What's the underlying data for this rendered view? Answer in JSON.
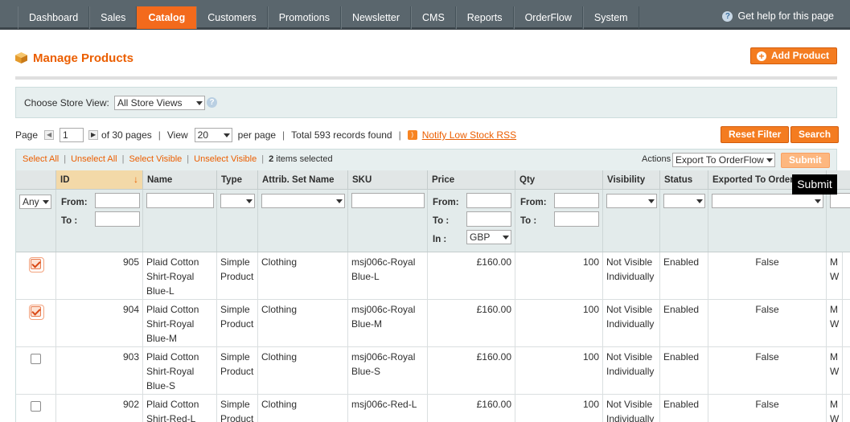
{
  "nav": {
    "items": [
      {
        "label": "Dashboard",
        "active": false
      },
      {
        "label": "Sales",
        "active": false
      },
      {
        "label": "Catalog",
        "active": true
      },
      {
        "label": "Customers",
        "active": false
      },
      {
        "label": "Promotions",
        "active": false
      },
      {
        "label": "Newsletter",
        "active": false
      },
      {
        "label": "CMS",
        "active": false
      },
      {
        "label": "Reports",
        "active": false
      },
      {
        "label": "OrderFlow",
        "active": false
      },
      {
        "label": "System",
        "active": false
      }
    ],
    "help_label": "Get help for this page"
  },
  "header": {
    "title": "Manage Products",
    "add_button": "Add Product"
  },
  "store_view": {
    "label": "Choose Store View:",
    "selected": "All Store Views"
  },
  "pager": {
    "page_label": "Page",
    "current_page": "1",
    "of_pages": "of 30 pages",
    "view_label": "View",
    "per_page_value": "20",
    "per_page_label": "per page",
    "total": "Total 593 records found",
    "rss_link": "Notify Low Stock RSS",
    "reset_button": "Reset Filter",
    "search_button": "Search"
  },
  "massaction": {
    "select_all": "Select All",
    "unselect_all": "Unselect All",
    "select_visible": "Select Visible",
    "unselect_visible": "Unselect Visible",
    "selected_count": "2",
    "selected_suffix": "items selected",
    "actions_label": "Actions",
    "actions_value": "Export To OrderFlow",
    "submit": "Submit",
    "tooltip": "Submit"
  },
  "columns": {
    "id": "ID",
    "name": "Name",
    "type": "Type",
    "attr_set": "Attrib. Set Name",
    "sku": "SKU",
    "price": "Price",
    "qty": "Qty",
    "visibility": "Visibility",
    "status": "Status",
    "exported": "Exported To OrderFlow"
  },
  "filters": {
    "massaction_any": "Any",
    "from": "From:",
    "to": "To :",
    "in": "In :",
    "currency": "GBP"
  },
  "rows": [
    {
      "checked": true,
      "id": "905",
      "name": "Plaid Cotton Shirt-Royal Blue-L",
      "type": "Simple Product",
      "attr_set": "Clothing",
      "sku": "msj006c-Royal Blue-L",
      "price": "£160.00",
      "qty": "100",
      "visibility": "Not Visible Individually",
      "status": "Enabled",
      "exported": "False",
      "extra": "M W"
    },
    {
      "checked": true,
      "id": "904",
      "name": "Plaid Cotton Shirt-Royal Blue-M",
      "type": "Simple Product",
      "attr_set": "Clothing",
      "sku": "msj006c-Royal Blue-M",
      "price": "£160.00",
      "qty": "100",
      "visibility": "Not Visible Individually",
      "status": "Enabled",
      "exported": "False",
      "extra": "M W"
    },
    {
      "checked": false,
      "id": "903",
      "name": "Plaid Cotton Shirt-Royal Blue-S",
      "type": "Simple Product",
      "attr_set": "Clothing",
      "sku": "msj006c-Royal Blue-S",
      "price": "£160.00",
      "qty": "100",
      "visibility": "Not Visible Individually",
      "status": "Enabled",
      "exported": "False",
      "extra": "M W"
    },
    {
      "checked": false,
      "id": "902",
      "name": "Plaid Cotton Shirt-Red-L",
      "type": "Simple Product",
      "attr_set": "Clothing",
      "sku": "msj006c-Red-L",
      "price": "£160.00",
      "qty": "100",
      "visibility": "Not Visible Individually",
      "status": "Enabled",
      "exported": "False",
      "extra": "M W"
    }
  ]
}
